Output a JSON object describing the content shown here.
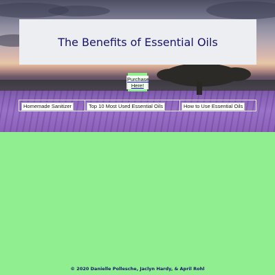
{
  "page": {
    "title": "The Benefits of Essential Oils",
    "purchase_button": "Purchase Here!",
    "footer": "© 2020 Danielle Pollesche, Jaclyn Hardy, & April Rohl"
  },
  "nav": {
    "links": [
      "Homemade Sanitizer",
      "Top 10 Most Used Essential Oils",
      "How to Use Essential Oils"
    ]
  },
  "colors": {
    "page_background": "#90ee90",
    "title_text": "#14146e",
    "title_box": "#eceef2"
  }
}
